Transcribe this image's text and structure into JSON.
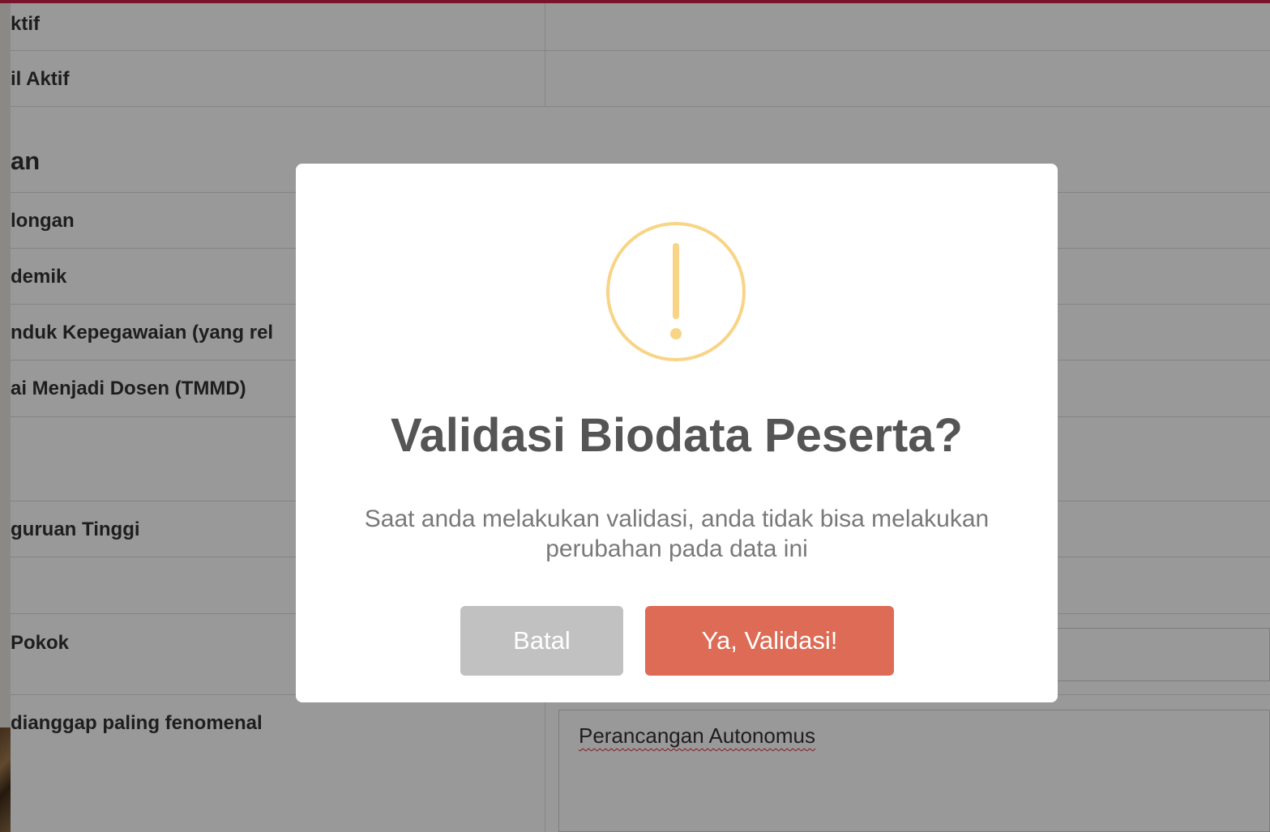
{
  "background_form": {
    "rows": [
      {
        "label": "ktif"
      },
      {
        "label": "il Aktif"
      },
      {
        "label": "longan"
      },
      {
        "label": "demik"
      },
      {
        "label": "nduk Kepegawaian (yang rel"
      },
      {
        "label": "ai Menjadi Dosen (TMMD)"
      },
      {
        "label": "guruan Tinggi"
      },
      {
        "label": " Pokok"
      },
      {
        "label": "dianggap paling fenomenal"
      }
    ],
    "section_title": "an",
    "textarea_value": "Perancangan Autonomus"
  },
  "dialog": {
    "icon": "warning-exclamation-icon",
    "icon_color": "#f8d486",
    "title": "Validasi Biodata Peserta?",
    "text": "Saat anda melakukan validasi, anda tidak bisa melakukan perubahan pada data ini",
    "cancel_label": "Batal",
    "confirm_label": "Ya, Validasi!",
    "confirm_color": "#dd6b55",
    "cancel_color": "#c1c1c1"
  },
  "colors": {
    "top_bar": "#c8234a"
  }
}
